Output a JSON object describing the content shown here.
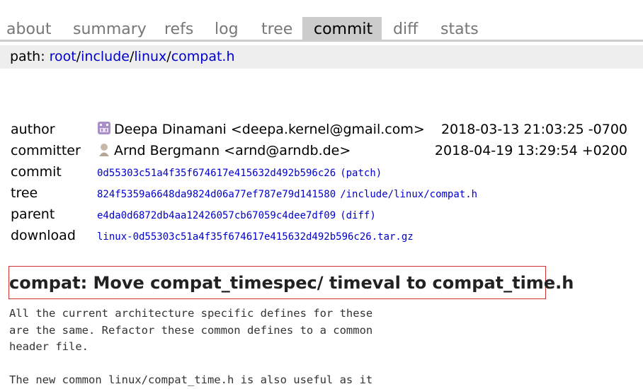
{
  "tabs": [
    "about",
    "summary",
    "refs",
    "log",
    "tree",
    "commit",
    "diff",
    "stats"
  ],
  "active_tab": "commit",
  "path": {
    "label": "path: ",
    "parts": [
      "root",
      "include",
      "linux",
      "compat.h"
    ],
    "separator": "/"
  },
  "commit_info": {
    "author": {
      "label": "author",
      "name": "Deepa Dinamani <deepa.kernel@gmail.com>",
      "date": "2018-03-13 21:03:25 -0700"
    },
    "committer": {
      "label": "committer",
      "name": "Arnd Bergmann <arnd@arndb.de>",
      "date": "2018-04-19 13:29:54 +0200"
    },
    "commit": {
      "label": "commit",
      "hash": "0d55303c51a4f35f674617e415632d492b596c26",
      "link": "(patch)"
    },
    "tree": {
      "label": "tree",
      "hash": "824f5359a6648da9824d06a77ef787e79d141580",
      "link": "/include/linux/compat.h"
    },
    "parent": {
      "label": "parent",
      "hash": "e4da0d6872db4aa12426057cb67059c4dee7df09",
      "link": "(diff)"
    },
    "download": {
      "label": "download",
      "file": "linux-0d55303c51a4f35f674617e415632d492b596c26.tar.gz"
    }
  },
  "subject": "compat: Move compat_timespec/ timeval to compat_time.h",
  "message": "All the current architecture specific defines for these\nare the same. Refactor these common defines to a common\nheader file.\n\nThe new common linux/compat_time.h is also useful as it",
  "colors": {
    "link": "#0000cc",
    "tab_active_bg": "#cccccc",
    "tab_inactive": "#777777",
    "pathbar_bg": "#eeeeee",
    "subject_border": "#cc3333"
  }
}
